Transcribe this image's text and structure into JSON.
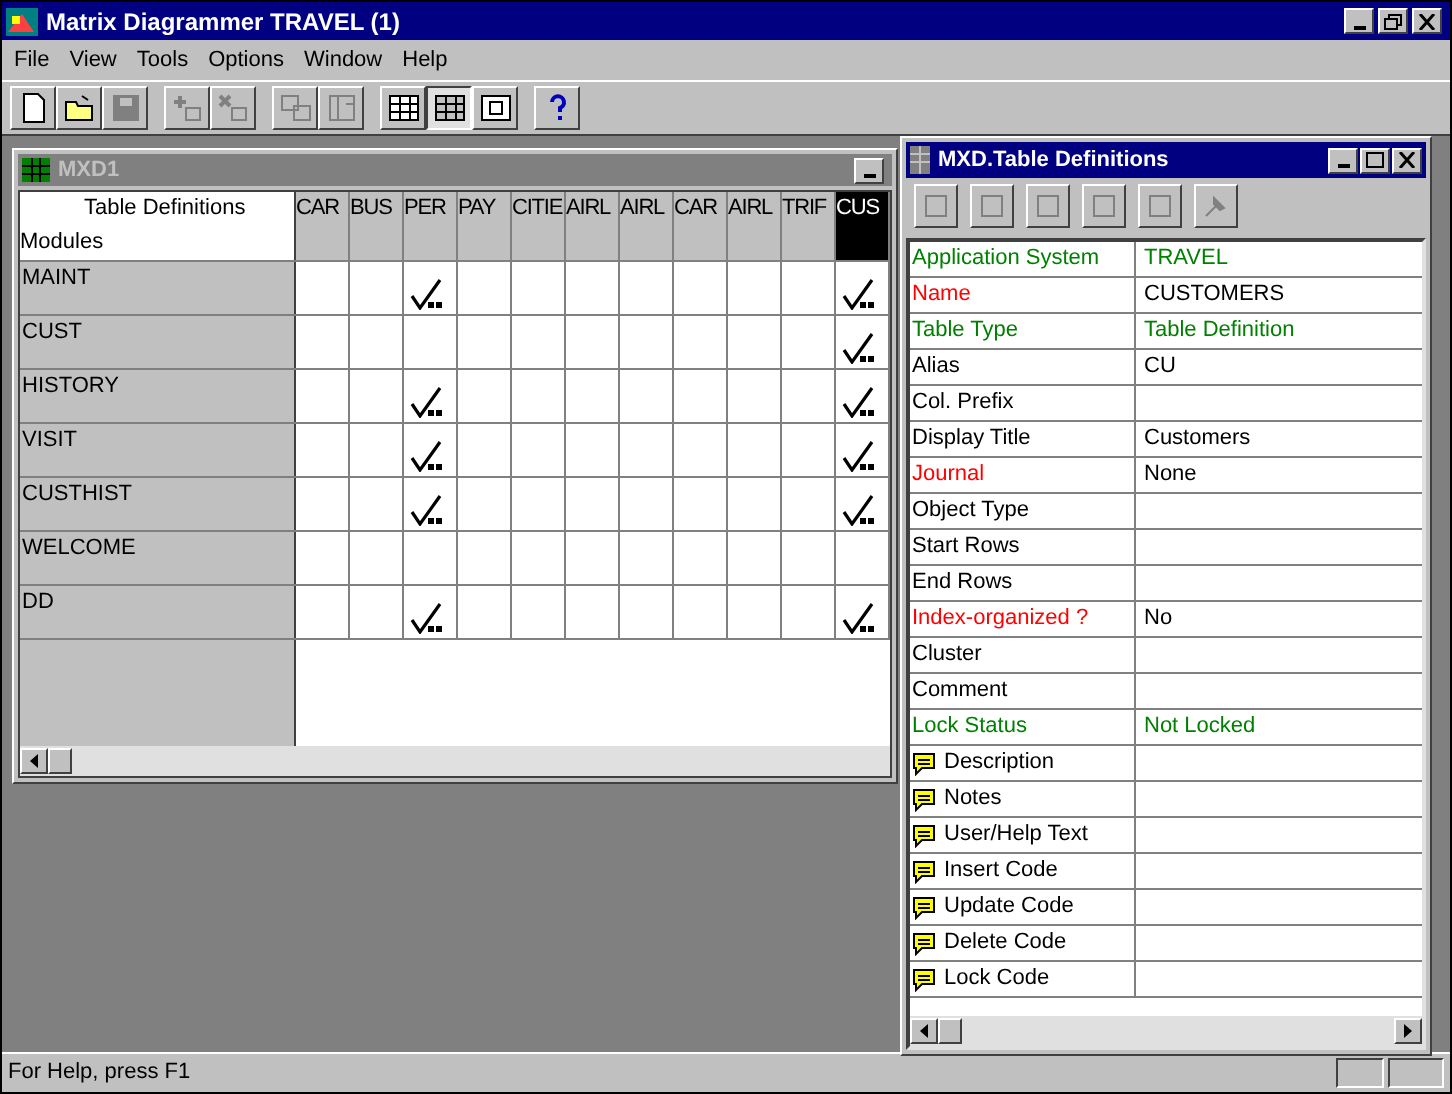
{
  "window": {
    "title": "Matrix Diagrammer TRAVEL (1)"
  },
  "menu": [
    "File",
    "View",
    "Tools",
    "Options",
    "Window",
    "Help"
  ],
  "toolbar": [
    {
      "disabled": false,
      "pressed": false
    },
    {
      "disabled": false,
      "pressed": false
    },
    {
      "disabled": true,
      "pressed": false
    },
    {
      "disabled": true,
      "pressed": false
    },
    {
      "disabled": true,
      "pressed": false
    },
    {
      "disabled": true,
      "pressed": false
    },
    {
      "disabled": true,
      "pressed": false
    },
    {
      "disabled": false,
      "pressed": false
    },
    {
      "disabled": false,
      "pressed": true
    },
    {
      "disabled": false,
      "pressed": false
    },
    {
      "disabled": false,
      "pressed": false
    }
  ],
  "matrix_window": {
    "title": "MXD1",
    "corner_top": "Table Definitions",
    "corner_bottom": "Modules",
    "columns": [
      {
        "label": "CAR",
        "selected": false
      },
      {
        "label": "BUS",
        "selected": false
      },
      {
        "label": "PER",
        "selected": false
      },
      {
        "label": "PAY",
        "selected": false
      },
      {
        "label": "CITIE",
        "selected": false
      },
      {
        "label": "AIRL",
        "selected": false
      },
      {
        "label": "AIRL",
        "selected": false
      },
      {
        "label": "CAR",
        "selected": false
      },
      {
        "label": "AIRL",
        "selected": false
      },
      {
        "label": "TRIF",
        "selected": false
      },
      {
        "label": "CUS",
        "selected": true
      }
    ],
    "rows": [
      {
        "label": "MAINT",
        "cells": [
          false,
          false,
          true,
          false,
          false,
          false,
          false,
          false,
          false,
          false,
          true
        ]
      },
      {
        "label": "CUST",
        "cells": [
          false,
          false,
          false,
          false,
          false,
          false,
          false,
          false,
          false,
          false,
          true
        ]
      },
      {
        "label": "HISTORY",
        "cells": [
          false,
          false,
          true,
          false,
          false,
          false,
          false,
          false,
          false,
          false,
          true
        ]
      },
      {
        "label": "VISIT",
        "cells": [
          false,
          false,
          true,
          false,
          false,
          false,
          false,
          false,
          false,
          false,
          true
        ]
      },
      {
        "label": "CUSTHIST",
        "cells": [
          false,
          false,
          true,
          false,
          false,
          false,
          false,
          false,
          false,
          false,
          true
        ]
      },
      {
        "label": "WELCOME",
        "cells": [
          false,
          false,
          false,
          false,
          false,
          false,
          false,
          false,
          false,
          false,
          false
        ]
      },
      {
        "label": "DD",
        "cells": [
          false,
          false,
          true,
          false,
          false,
          false,
          false,
          false,
          false,
          false,
          true
        ]
      }
    ]
  },
  "properties_window": {
    "title": "MXD.Table Definitions",
    "rows": [
      {
        "kind": "field",
        "label": "Application System",
        "value": {
          "text": "TRAVEL",
          "color": "#008000"
        },
        "color": "#008000"
      },
      {
        "kind": "field",
        "label": "Name",
        "value": {
          "text": "CUSTOMERS",
          "color": "#000000"
        },
        "color": "#ff0000"
      },
      {
        "kind": "field",
        "label": "Table Type",
        "value": {
          "text": "Table Definition",
          "color": "#008000"
        },
        "color": "#008000"
      },
      {
        "kind": "field",
        "label": "Alias",
        "value": {
          "text": "CU",
          "color": "#000000"
        },
        "color": "#000000"
      },
      {
        "kind": "field",
        "label": "Col. Prefix",
        "color": "#000000"
      },
      {
        "kind": "field",
        "label": "Display Title",
        "value": {
          "text": "Customers",
          "color": "#000000"
        },
        "color": "#000000"
      },
      {
        "kind": "field",
        "label": "Journal",
        "value": {
          "text": "None",
          "color": "#000000"
        },
        "color": "#ff0000"
      },
      {
        "kind": "field",
        "label": "Object Type",
        "color": "#000000"
      },
      {
        "kind": "field",
        "label": "Start Rows",
        "color": "#000000"
      },
      {
        "kind": "field",
        "label": "End Rows",
        "color": "#000000"
      },
      {
        "kind": "field",
        "label": "Index-organized ?",
        "value": {
          "text": "No",
          "color": "#000000"
        },
        "color": "#ff0000"
      },
      {
        "kind": "field",
        "label": "Cluster",
        "color": "#000000"
      },
      {
        "kind": "field",
        "label": "Comment",
        "color": "#000000"
      },
      {
        "kind": "field",
        "label": "Lock Status",
        "value": {
          "text": "Not Locked",
          "color": "#008000"
        },
        "color": "#008000"
      },
      {
        "kind": "note",
        "label": "Description",
        "color": "#000000"
      },
      {
        "kind": "note",
        "label": "Notes",
        "color": "#000000"
      },
      {
        "kind": "note",
        "label": "User/Help Text",
        "color": "#000000"
      },
      {
        "kind": "note",
        "label": "Insert Code",
        "color": "#000000"
      },
      {
        "kind": "note",
        "label": "Update Code",
        "color": "#000000"
      },
      {
        "kind": "note",
        "label": "Delete Code",
        "color": "#000000"
      },
      {
        "kind": "note",
        "label": "Lock Code",
        "color": "#000000"
      }
    ]
  },
  "status_bar": "For Help, press F1"
}
